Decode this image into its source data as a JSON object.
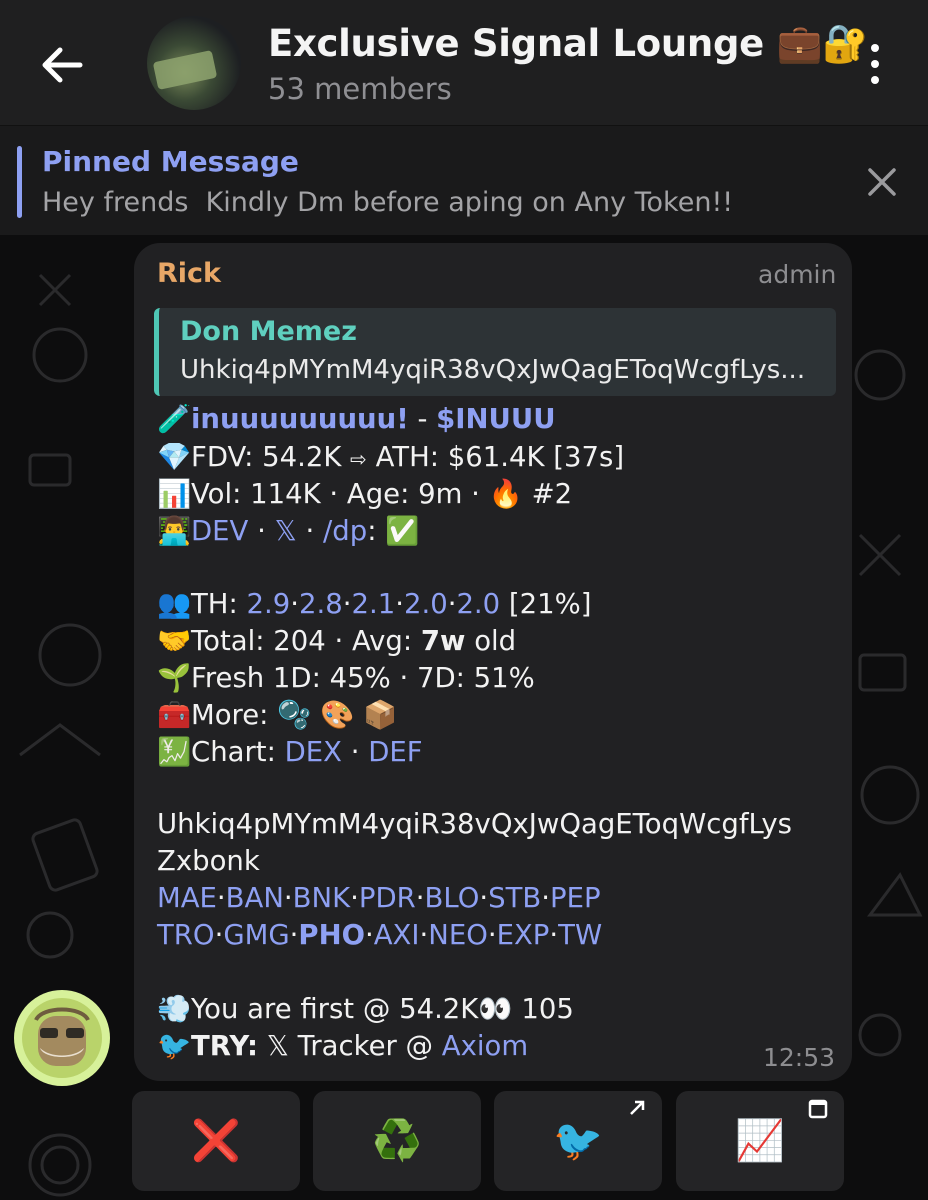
{
  "header": {
    "title": "Exclusive Signal Lounge 💼🔐",
    "members": "53 members"
  },
  "pinned": {
    "title": "Pinned Message",
    "text": "Hey frends  Kindly Dm before aping on Any Token!!"
  },
  "message": {
    "sender": "Rick",
    "role": "admin",
    "reply": {
      "name": "Don Memez",
      "text": "Uhkiq4pMYmM4yqiR38vQxJwQagEToqWcgfLys..."
    },
    "token_line": {
      "name": "inuuuuuuuuu!",
      "sep": " - ",
      "ticker": "$INUUU"
    },
    "fdv_line": {
      "fdv": "FDV: 54.2K",
      "arrow": "⇨",
      "ath": "ATH: $61.4K [37s]"
    },
    "vol_line": {
      "text": "Vol: 114K · Age: 9m ·",
      "rank": "#2"
    },
    "dev_line": {
      "dev": "DEV",
      "x": "𝕏",
      "dp": "/dp",
      "colon": ":"
    },
    "th_line": {
      "label": "TH:",
      "values": [
        "2.9",
        "2.8",
        "2.1",
        "2.0",
        "2.0"
      ],
      "pct": "[21%]"
    },
    "total_line": {
      "text": "Total: 204 · Avg:",
      "age": "7w",
      "suffix": "old"
    },
    "fresh_line": "Fresh 1D: 45% · 7D: 51%",
    "more_line": "More:",
    "chart_line": {
      "label": "Chart:",
      "dex": "DEX",
      "def": "DEF"
    },
    "address": [
      "Uhkiq4pMYmM4yqiR38vQxJwQagEToqWcgfLys",
      "Zxbonk"
    ],
    "links_row1": [
      "MAE",
      "BAN",
      "BNK",
      "PDR",
      "BLO",
      "STB",
      "PEP"
    ],
    "links_row2": [
      "TRO",
      "GMG",
      "PHO",
      "AXI",
      "NEO",
      "EXP",
      "TW"
    ],
    "first_line": {
      "text": "You are first @ 54.2K",
      "count": "105"
    },
    "try_line": {
      "label": "TRY:",
      "text": "𝕏 Tracker @",
      "link": "Axiom"
    },
    "time": "12:53"
  },
  "keyboard": [
    {
      "icon": "❌"
    },
    {
      "icon": "♻️"
    },
    {
      "icon": "🐦"
    },
    {
      "icon": "📈"
    }
  ],
  "colors": {
    "accent": "#8ea0f2",
    "sender": "#e8a767",
    "reply": "#4fc7b5"
  }
}
